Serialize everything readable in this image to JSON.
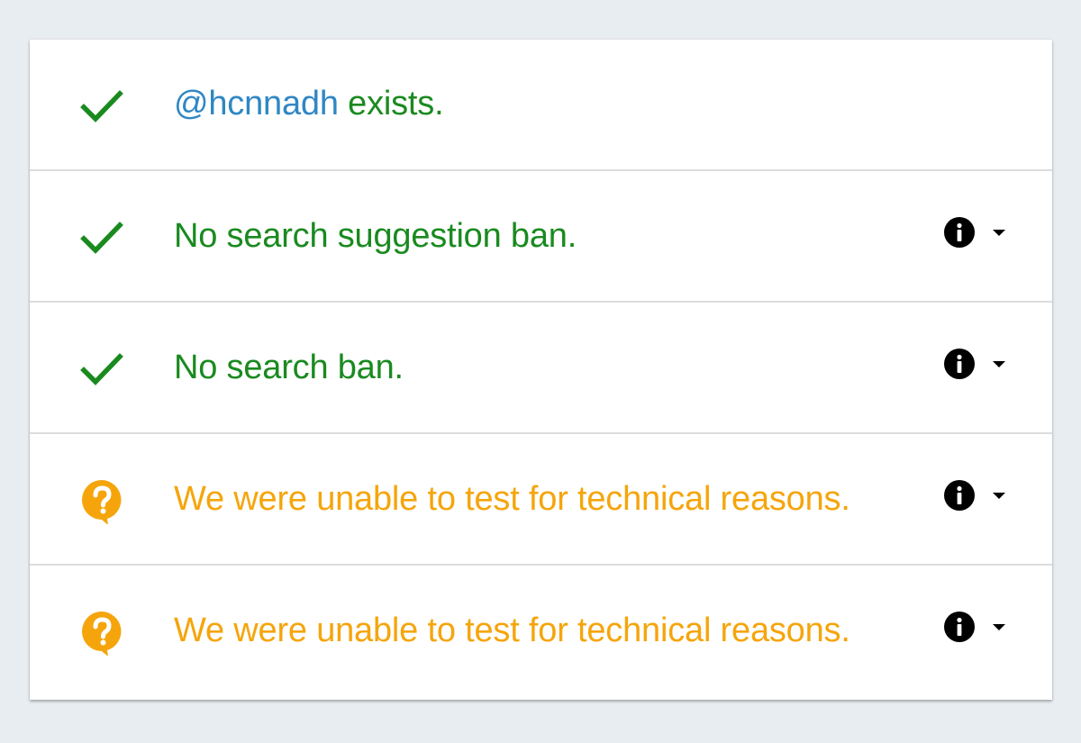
{
  "results": [
    {
      "status": "ok",
      "icon": "check-icon",
      "handle": "@hcnnadh",
      "text": " exists.",
      "has_details": false
    },
    {
      "status": "ok",
      "icon": "check-icon",
      "text": "No search suggestion ban.",
      "has_details": true
    },
    {
      "status": "ok",
      "icon": "check-icon",
      "text": "No search ban.",
      "has_details": true
    },
    {
      "status": "unknown",
      "icon": "question-bubble-icon",
      "text": "We were unable to test for technical reasons.",
      "has_details": true
    },
    {
      "status": "unknown",
      "icon": "question-bubble-icon",
      "text": "We were unable to test for technical reasons.",
      "has_details": true
    }
  ],
  "colors": {
    "ok": "#1a8a1f",
    "unknown": "#f5a50b",
    "handle": "#2f87c4",
    "background": "#e8edf1"
  }
}
